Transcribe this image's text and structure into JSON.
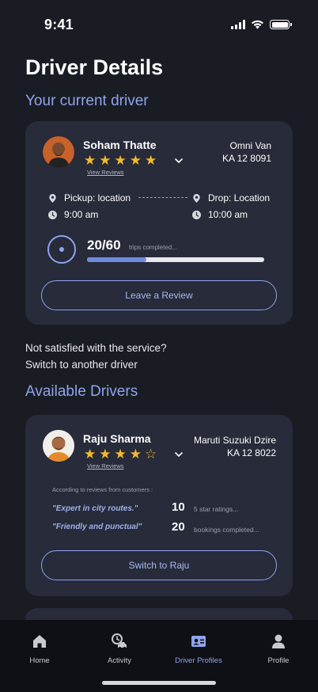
{
  "status_bar": {
    "time": "9:41"
  },
  "page_title": "Driver Details",
  "current_section_title": "Your current driver",
  "current_driver": {
    "name": "Soham Thatte",
    "rating": 5,
    "max_rating": 5,
    "view_reviews": "View Reviews",
    "vehicle_model": "Omni Van",
    "vehicle_plate": "KA 12 8091",
    "pickup": "Pickup: location",
    "drop": "Drop: Location",
    "pickup_time": "9:00 am",
    "drop_time": "10:00 am",
    "trips_done": "20/60",
    "trips_label": "trips completed...",
    "trips_progress": 0.333,
    "review_button": "Leave a Review"
  },
  "switch_prompt": {
    "line1": "Not satisfied with the service?",
    "line2": "Switch to another driver"
  },
  "available_section_title": "Available Drivers",
  "available_drivers": [
    {
      "name": "Raju Sharma",
      "rating": 4,
      "max_rating": 5,
      "view_reviews": "View Reviews",
      "vehicle_model": "Maruti Suzuki Dzire",
      "vehicle_plate": "KA 12 8022",
      "reviews_note": "According to reviews from customers :",
      "quote1": "\"Expert in city routes.\"",
      "quote2": "\"Friendly and punctual\"",
      "stat1_value": "10",
      "stat1_label": "5 star ratings...",
      "stat2_value": "20",
      "stat2_label": "bookings completed...",
      "switch_button": "Switch to Raju"
    }
  ],
  "tab_bar": {
    "tabs": [
      {
        "label": "Home",
        "icon": "home-icon"
      },
      {
        "label": "Activity",
        "icon": "activity-icon"
      },
      {
        "label": "Driver Profiles",
        "icon": "driver-id-card-icon"
      },
      {
        "label": "Profile",
        "icon": "person-icon"
      }
    ],
    "active_tab": "Driver Profiles",
    "accent_color": "#8ea4ec"
  }
}
